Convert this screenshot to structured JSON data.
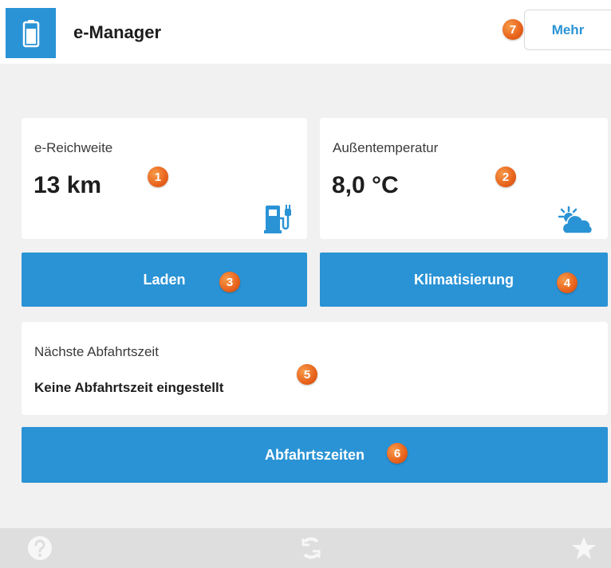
{
  "header": {
    "title": "e-Manager",
    "app_icon": "battery-icon",
    "more_label": "Mehr",
    "more_badge": "7"
  },
  "range_card": {
    "label": "e-Reichweite",
    "value": "13 km",
    "badge": "1",
    "icon": "charging-station-icon"
  },
  "temp_card": {
    "label": "Außentemperatur",
    "value": "8,0 °C",
    "badge": "2",
    "icon": "partly-cloudy-icon"
  },
  "buttons": {
    "charge_label": "Laden",
    "charge_badge": "3",
    "climate_label": "Klimatisierung",
    "climate_badge": "4",
    "departures_label": "Abfahrtszeiten",
    "departures_badge": "6"
  },
  "departure_card": {
    "label": "Nächste Abfahrtszeit",
    "value": "Keine Abfahrtszeit eingestellt",
    "badge": "5"
  },
  "footer": {
    "icons": [
      "help-icon",
      "refresh-icon",
      "favorite-star-icon"
    ]
  },
  "colors": {
    "accent": "#2a93d5",
    "badge": "#e8621c",
    "background": "#f1f1f1",
    "footer": "#dedede"
  }
}
